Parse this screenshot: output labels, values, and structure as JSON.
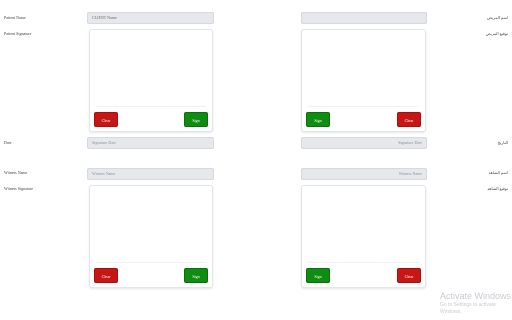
{
  "left_form": {
    "patient_name_label": "Patient Name",
    "patient_name_value": "CLIENT Name",
    "patient_signature_label": "Patient Signature",
    "date_label": "Date",
    "date_placeholder": "Signature Date",
    "witness_name_label": "Witness Name",
    "witness_name_placeholder": "Witness Name",
    "witness_signature_label": "Witness Signature",
    "clear_label": "Clear",
    "sign_label": "Sign"
  },
  "right_form": {
    "patient_name_label": "اسم المريض",
    "patient_name_value": "",
    "patient_signature_label": "توقيع المريض",
    "date_label": "التاريخ",
    "date_placeholder": "Signature Date",
    "witness_name_label": "اسم الشاهد",
    "witness_name_placeholder": "Witness Name",
    "witness_signature_label": "توقيع الشاهد",
    "clear_label": "Clear",
    "sign_label": "Sign"
  },
  "watermark": {
    "title": "Activate Windows",
    "subtitle": "Go to Settings to activate Windows."
  },
  "colors": {
    "clear_button": "#c61717",
    "sign_button": "#0f8c12",
    "field_background": "#e6e8eb"
  }
}
